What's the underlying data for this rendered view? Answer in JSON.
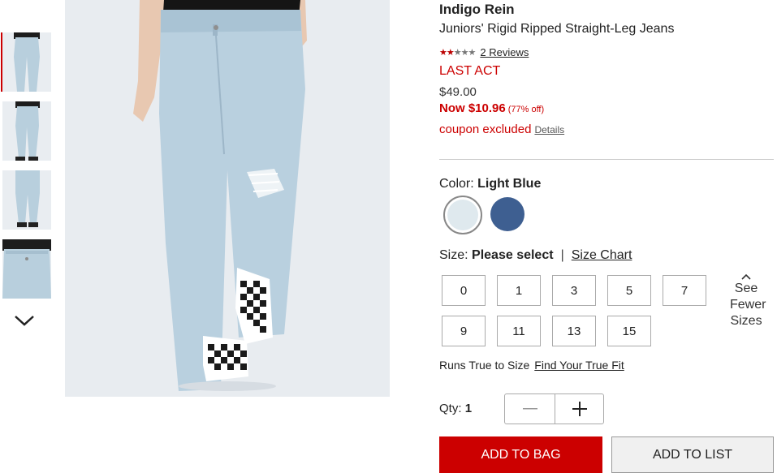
{
  "product": {
    "brand": "Indigo Rein",
    "title": "Juniors' Rigid Ripped Straight-Leg Jeans",
    "rating": {
      "stars_filled": 2,
      "stars_total": 5,
      "reviews_label": "2 Reviews"
    },
    "promo_label": "LAST ACT",
    "original_price": "$49.00",
    "sale_price": "Now $10.96",
    "discount": "(77% off)",
    "coupon_text": "coupon excluded",
    "details_link": "Details"
  },
  "color": {
    "label": "Color:",
    "selected": "Light Blue",
    "swatches": [
      {
        "name": "Light Blue",
        "hex": "#dfe9ee",
        "selected": true
      },
      {
        "name": "Dark Blue",
        "hex": "#3e5f91",
        "selected": false
      }
    ]
  },
  "size": {
    "label": "Size:",
    "selected": "Please select",
    "separator": "|",
    "chart_link": "Size Chart",
    "options": [
      "0",
      "1",
      "3",
      "5",
      "7",
      "9",
      "11",
      "13",
      "15"
    ],
    "see_fewer": [
      "See",
      "Fewer",
      "Sizes"
    ]
  },
  "fit": {
    "text": "Runs True to Size",
    "link": "Find Your True Fit"
  },
  "quantity": {
    "label": "Qty:",
    "value": "1"
  },
  "actions": {
    "add_to_bag": "ADD TO BAG",
    "add_to_list": "ADD TO LIST"
  },
  "colors": {
    "accent": "#cc0000"
  }
}
